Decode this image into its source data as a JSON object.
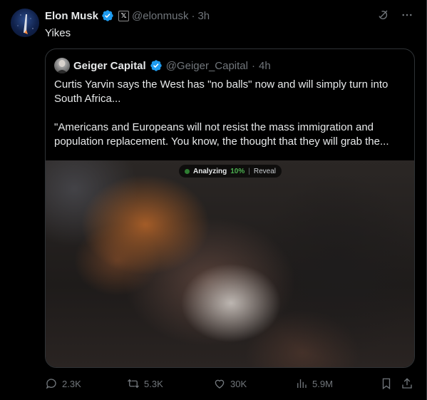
{
  "tweet": {
    "author_name": "Elon Musk",
    "handle": "@elonmusk",
    "time": "3h",
    "text": "Yikes",
    "x_badge": "𝕏"
  },
  "quote": {
    "author_name": "Geiger Capital",
    "handle": "@Geiger_Capital",
    "time": "4h",
    "paragraph1": "Curtis Yarvin says the West has \"no balls\" now and will simply turn into South Africa...",
    "paragraph2": "\"Americans and Europeans will not resist the mass immigration and population replacement. You know, the thought that they will grab the...",
    "media_status": {
      "label": "Analyzing",
      "percent": "10%",
      "separator": "|",
      "reveal": "Reveal"
    }
  },
  "actions": {
    "replies": "2.3K",
    "reposts": "5.3K",
    "likes": "30K",
    "views": "5.9M"
  },
  "separators": {
    "dot": "·"
  },
  "icons": {
    "verified": "verified-badge-icon",
    "reply": "reply-icon",
    "repost": "repost-icon",
    "like": "heart-icon",
    "views": "views-chart-icon",
    "bookmark": "bookmark-icon",
    "share": "share-icon",
    "grok": "grok-icon",
    "more": "more-icon"
  },
  "colors": {
    "verified": "#1d9bf0",
    "muted": "#71767b",
    "text": "#e7e9ea",
    "analyzing_green": "#4caf50"
  }
}
